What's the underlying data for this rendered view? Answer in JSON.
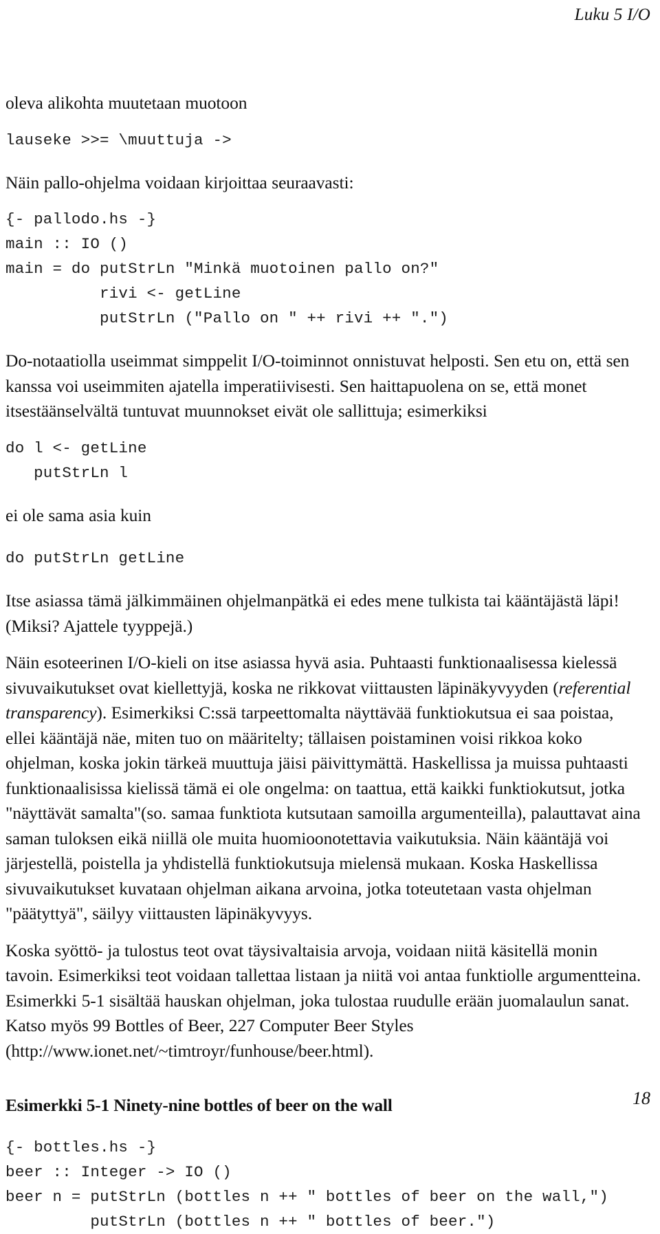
{
  "header": {
    "running_head": "Luku 5 I/O"
  },
  "footer": {
    "page_number": "18"
  },
  "content": {
    "para_1": "oleva alikohta muutetaan muotoon",
    "code_1": "lauseke >>= \\muuttuja ->",
    "para_2": "Näin pallo-ohjelma voidaan kirjoittaa seuraavasti:",
    "code_2": "{- pallodo.hs -}\nmain :: IO ()\nmain = do putStrLn \"Minkä muotoinen pallo on?\"\n          rivi <- getLine\n          putStrLn (\"Pallo on \" ++ rivi ++ \".\")",
    "para_3": "Do-notaatiolla useimmat simppelit I/O-toiminnot onnistuvat helposti. Sen etu on, että sen kanssa voi useimmiten ajatella imperatiivisesti. Sen haittapuolena on se, että monet itsestäänselvältä tuntuvat muunnokset eivät ole sallittuja; esimerkiksi",
    "code_3": "do l <- getLine\n   putStrLn l",
    "para_4": "ei ole sama asia kuin",
    "code_4": "do putStrLn getLine",
    "para_5": "Itse asiassa tämä jälkimmäinen ohjelmanpätkä ei edes mene tulkista tai kääntäjästä läpi! (Miksi? Ajattele tyyppejä.)",
    "para_6_a": "Näin esoteerinen I/O-kieli on itse asiassa hyvä asia. Puhtaasti funktionaalisessa kielessä sivuvaikutukset ovat kiellettyjä, koska ne rikkovat viittausten läpinäkyvyyden (",
    "para_6_italic": "referential transparency",
    "para_6_b": "). Esimerkiksi C:ssä tarpeettomalta näyttävää funktiokutsua ei saa poistaa, ellei kääntäjä näe, miten tuo on määritelty; tällaisen poistaminen voisi rikkoa koko ohjelman, koska jokin tärkeä muuttuja jäisi päivittymättä. Haskellissa ja muissa puhtaasti funktionaalisissa kielissä tämä ei ole ongelma: on taattua, että kaikki funktiokutsut, jotka \"näyttävät samalta\"(so. samaa funktiota kutsutaan samoilla argumenteilla), palauttavat aina saman tuloksen eikä niillä ole muita huomioonotettavia vaikutuksia. Näin kääntäjä voi järjestellä, poistella ja yhdistellä funktiokutsuja mielensä mukaan. Koska Haskellissa sivuvaikutukset kuvataan ohjelman aikana arvoina, jotka toteutetaan vasta ohjelman \"päätyttyä\", säilyy viittausten läpinäkyvyys.",
    "para_7": "Koska syöttö- ja tulostus teot ovat täysivaltaisia arvoja, voidaan niitä käsitellä monin tavoin. Esimerkiksi teot voidaan tallettaa listaan ja niitä voi antaa funktiolle argumentteina. Esimerkki 5-1 sisältää hauskan ohjelman, joka tulostaa ruudulle erään juomalaulun sanat. Katso myös 99 Bottles of Beer, 227 Computer Beer Styles (http://www.ionet.net/~timtroyr/funhouse/beer.html).",
    "example_heading": "Esimerkki 5-1 Ninety-nine bottles of beer on the wall",
    "code_5": "{- bottles.hs -}\nbeer :: Integer -> IO ()\nbeer n = putStrLn (bottles n ++ \" bottles of beer on the wall,\")       >>\n         putStrLn (bottles n ++ \" bottles of beer.\")                   >>"
  }
}
